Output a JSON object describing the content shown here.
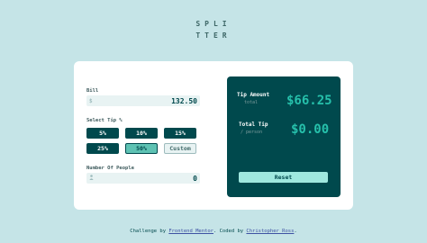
{
  "logo": {
    "line1": "SPLI",
    "line2": "TTER"
  },
  "bill": {
    "label": "Bill",
    "icon": "$",
    "value": "132.50"
  },
  "tip": {
    "label": "Select Tip %",
    "options": [
      "5%",
      "10%",
      "15%",
      "25%",
      "50%"
    ],
    "custom_label": "Custom",
    "selected": "50%"
  },
  "people": {
    "label": "Number Of People",
    "icon": "person-icon",
    "value": "0"
  },
  "result": {
    "tip_amount_title": "Tip Amount",
    "tip_amount_sub": "total",
    "tip_amount_value": "$66.25",
    "total_title": "Total Tip",
    "total_sub": "/ person",
    "total_value": "$0.00",
    "reset_label": "Reset"
  },
  "footer": {
    "prefix": "Challenge by ",
    "link1": "Frontend Mentor",
    "middle": ". Coded by ",
    "link2": "Christopher Ross",
    "suffix": "."
  },
  "colors": {
    "background": "#c5e4e7",
    "dark_teal": "#00494d",
    "accent": "#26c0ab",
    "selected_tip": "#5ec2b3"
  }
}
